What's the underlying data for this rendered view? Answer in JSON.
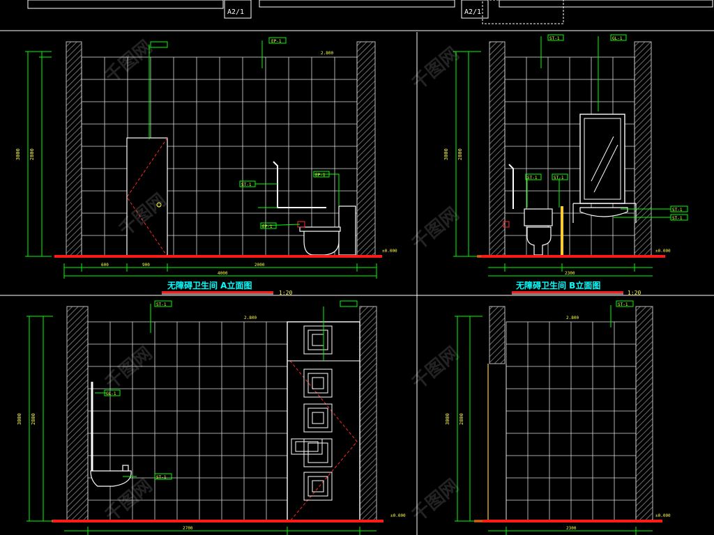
{
  "drawing": {
    "sheet_refs": [
      "A2/1",
      "A2/1"
    ],
    "watermark": "千图网"
  },
  "panels": {
    "a": {
      "title": "无障碍卫生间 A立面图",
      "scale": "1:20",
      "tags": [
        "ST-1",
        "EP-1",
        "ST-1",
        "EP-1",
        "EP-1"
      ],
      "levels": [
        "2.800",
        "±0.000"
      ]
    },
    "b": {
      "title": "无障碍卫生间 B立面图",
      "scale": "1:20",
      "tags": [
        "ST-1",
        "GL-1",
        "ST-1",
        "ST-1",
        "ST-1",
        "ST-1"
      ],
      "levels": [
        "±0.000"
      ]
    },
    "c": {
      "tags": [
        "ST-1",
        "GL-1",
        "ST-1"
      ],
      "levels": [
        "2.800",
        "±0.000"
      ]
    },
    "d": {
      "tags": [
        "ST-1"
      ],
      "levels": [
        "2.800",
        "±0.000"
      ]
    }
  },
  "colors": {
    "background": "#000000",
    "frame": "#ffffff",
    "dimension": "#00ff00",
    "tile_grid": "#ffffff",
    "wall_hatch": "#8a8a8a",
    "floor": "#ff1a1a",
    "door_swing": "#ff2a2a",
    "leader": "#00ff00",
    "tag": "#ffff40",
    "title": "#00ffff",
    "glass": "#00ffff"
  }
}
